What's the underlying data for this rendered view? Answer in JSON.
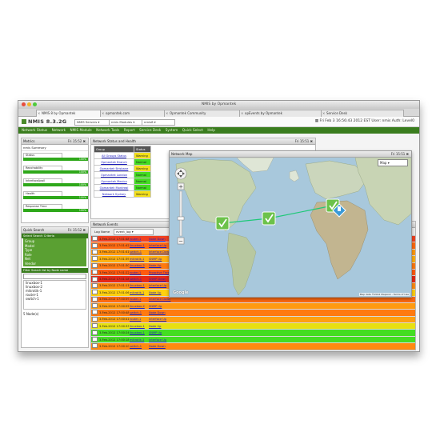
{
  "window": {
    "title": "NMIS by Opmantek",
    "tabs": [
      {
        "label": "NMIS 8 by Opmantek",
        "active": true
      },
      {
        "label": "opmantek.com"
      },
      {
        "label": "Opmantek Community"
      },
      {
        "label": "opEvents by Opmantek"
      },
      {
        "label": "Service Desk"
      }
    ]
  },
  "app": {
    "logo": "NMIS 8.3.2G",
    "selectors": [
      "NMIS Servers",
      "nmis Modules",
      "nmis8"
    ],
    "datetime": "Fri Feb 3 16:56:43 2012 EST  User: nmis  Auth: Level0"
  },
  "menu": [
    "Network Status",
    "Network",
    "NMIS Module",
    "Network Tools",
    "Report",
    "Service Desk",
    "System",
    "Quick Select",
    "Help"
  ],
  "metrics": {
    "title": "Metrics",
    "time": "Fri 15:52",
    "subtitle": "nmis Summary",
    "items": [
      {
        "label": "Status",
        "value": "100%",
        "level": 1.0
      },
      {
        "label": "Reachability",
        "value": "100%",
        "level": 1.0
      },
      {
        "label": "InterfaceAvail",
        "value": "100%",
        "level": 1.0
      },
      {
        "label": "Health",
        "value": "100%",
        "level": 1.0
      },
      {
        "label": "Response Time",
        "value": "100%",
        "level": 1.0
      }
    ]
  },
  "quicksearch": {
    "title": "Quick Search",
    "time": "Fri 15:52",
    "criteria_header": "Select Search Criteria",
    "criteria": [
      "Group",
      "Model",
      "Type",
      "Role",
      "Net",
      "Vendor"
    ],
    "filter_header": "Filter Search list by Node name",
    "nodes": [
      "linuxbox-1",
      "linuxbox-2",
      "mikrotik-1",
      "router-1",
      "switch-1"
    ],
    "count": "5 Node(s)"
  },
  "network_status": {
    "title": "Network Status and Health",
    "time": "Fri 15:51",
    "col_group": "Group",
    "col_status": "Status",
    "rows": [
      {
        "group": "All Groups Status",
        "status": "Warning",
        "color": "#f4e01a"
      },
      {
        "group": "Opmantek Branch",
        "status": "Normal",
        "color": "#44dd22"
      },
      {
        "group": "Opmantek Brisbane",
        "status": "Warning",
        "color": "#f4e01a"
      },
      {
        "group": "Opmantek London",
        "status": "Normal",
        "color": "#44dd22"
      },
      {
        "group": "Opmantek Mexico",
        "status": "Normal",
        "color": "#44dd22"
      },
      {
        "group": "Opmantek Montreal",
        "status": "Normal",
        "color": "#44dd22"
      },
      {
        "group": "Network Sydney",
        "status": "Warning",
        "color": "#f4e01a"
      }
    ]
  },
  "events": {
    "title": "Network Events",
    "log_label": "Log Name",
    "log_value": "event_log",
    "rows": [
      {
        "time": "3-Feb-2012 17:01:48",
        "node": "router-1",
        "event": "Node Down",
        "color": "#f04020"
      },
      {
        "time": "3-Feb-2012 17:01:42",
        "node": "linuxbox-1",
        "event": "Interface Up",
        "color": "#ff6a10"
      },
      {
        "time": "3-Feb-2012 17:01:41",
        "node": "switch-1",
        "event": "Interface Down",
        "color": "#ff9a10"
      },
      {
        "time": "3-Feb-2012 17:01:39",
        "node": "mikrotik-1",
        "event": "SNMP Up",
        "color": "#ffb010"
      },
      {
        "time": "3-Feb-2012 17:01:30",
        "node": "linuxbox-2",
        "event": "Node Up",
        "color": "#ff7a10"
      },
      {
        "time": "3-Feb-2012 17:01:22",
        "node": "router-1",
        "event": "Proactive Threshold",
        "color": "#ff5a10"
      },
      {
        "time": "3-Feb-2012 17:01:18",
        "node": "switch-1",
        "event": "SNMP Down",
        "color": "#e62818"
      },
      {
        "time": "3-Feb-2012 17:01:11",
        "node": "linuxbox-1",
        "event": "Interface Up",
        "color": "#ff8c10"
      },
      {
        "time": "3-Feb-2012 17:01:06",
        "node": "mikrotik-1",
        "event": "Node Up",
        "color": "#ffd010"
      },
      {
        "time": "3-Feb-2012 17:00:59",
        "node": "router-1",
        "event": "Interface Down",
        "color": "#ff6a10"
      },
      {
        "time": "3-Feb-2012 17:00:55",
        "node": "linuxbox-2",
        "event": "SNMP Up",
        "color": "#ff9a10"
      },
      {
        "time": "3-Feb-2012 17:00:48",
        "node": "switch-1",
        "event": "Node Down",
        "color": "#ff7a10"
      },
      {
        "time": "3-Feb-2012 17:00:41",
        "node": "router-1",
        "event": "Interface Up",
        "color": "#ffa010"
      },
      {
        "time": "3-Feb-2012 17:00:33",
        "node": "linuxbox-1",
        "event": "Node Up",
        "color": "#e8e010"
      },
      {
        "time": "3-Feb-2012 17:00:24",
        "node": "linuxbox-1",
        "event": "SNMP Up",
        "color": "#44dd22"
      },
      {
        "time": "3-Feb-2012 17:00:18",
        "node": "mikrotik-1",
        "event": "Interface Up",
        "color": "#44dd22"
      },
      {
        "time": "3-Feb-2012 17:00:10",
        "node": "switch-1",
        "event": "Node Down",
        "color": "#ff8a10"
      },
      {
        "time": "3-Feb-2012 17:00:05",
        "node": "router-1",
        "event": "Interface Down",
        "color": "#ff6a10"
      },
      {
        "time": "3-Feb-2012 16:59:57",
        "node": "linuxbox-2",
        "event": "SNMP Down",
        "color": "#e62818"
      },
      {
        "time": "3-Feb-2012 16:59:48",
        "node": "router-1",
        "event": "Node Up",
        "color": "#44dd22"
      },
      {
        "time": "3-Feb-2012 16:59:40",
        "node": "switch-1",
        "event": "Interface Up",
        "color": "#44dd22"
      },
      {
        "time": "3-Feb-2012 16:59:32",
        "node": "router-1",
        "event": "Node Up",
        "color": "#44dd22"
      },
      {
        "time": "3-Feb-2012 16:59:25",
        "node": "mikrotik-1",
        "event": "Interface Up",
        "color": "#44dd22"
      },
      {
        "time": "3-Feb-2012 16:59:18",
        "node": "linuxbox-1",
        "event": "Node Up",
        "color": "#44dd22"
      }
    ]
  },
  "map": {
    "title": "Network Map",
    "time": "Fri 15:51",
    "type_select": "Map",
    "attribution": "Map data ©2012 MapLink - Terms of Use",
    "google": "Google"
  }
}
